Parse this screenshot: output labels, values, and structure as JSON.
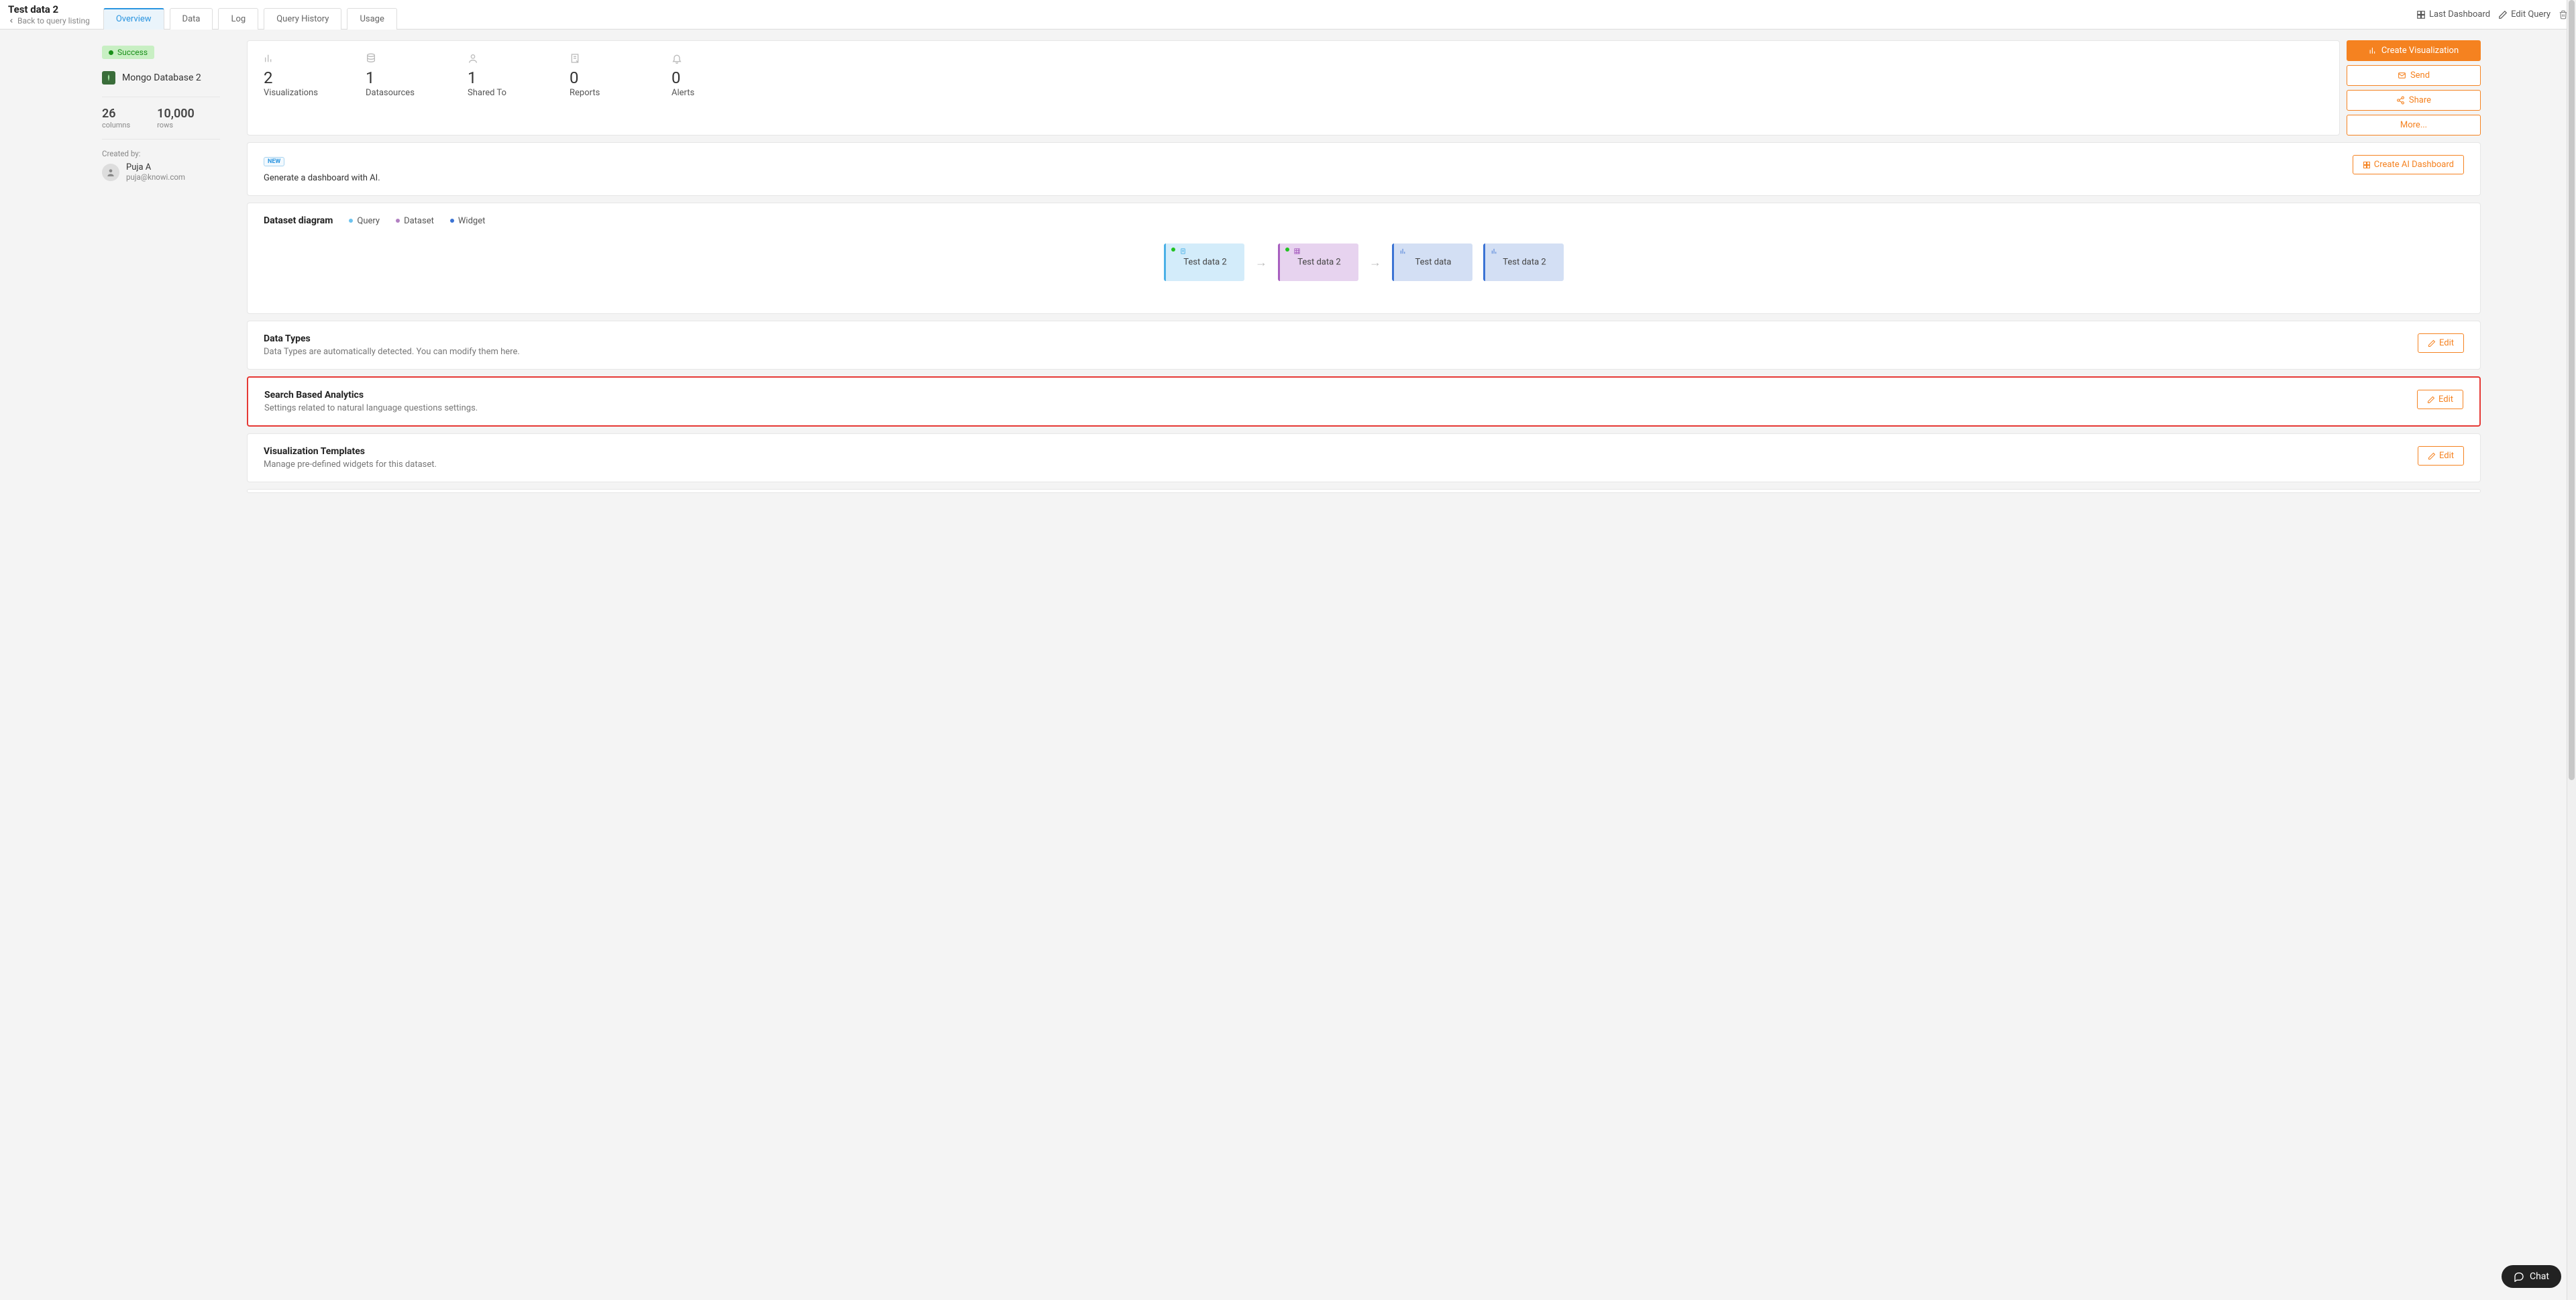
{
  "header": {
    "title": "Test data 2",
    "back_link": "Back to query listing",
    "tabs": [
      "Overview",
      "Data",
      "Log",
      "Query History",
      "Usage"
    ],
    "top_actions": {
      "last_dashboard": "Last Dashboard",
      "edit_query": "Edit Query"
    }
  },
  "sidebar": {
    "status": "Success",
    "database_name": "Mongo Database 2",
    "columns": {
      "value": "26",
      "label": "columns"
    },
    "rows": {
      "value": "10,000",
      "label": "rows"
    },
    "created_by_label": "Created by:",
    "creator": {
      "name": "Puja A",
      "email": "puja@knowi.com"
    }
  },
  "stats": [
    {
      "value": "2",
      "label": "Visualizations"
    },
    {
      "value": "1",
      "label": "Datasources"
    },
    {
      "value": "1",
      "label": "Shared To"
    },
    {
      "value": "0",
      "label": "Reports"
    },
    {
      "value": "0",
      "label": "Alerts"
    }
  ],
  "actions": {
    "create_visualization": "Create Visualization",
    "send": "Send",
    "share": "Share",
    "more": "More..."
  },
  "ai_card": {
    "new_badge": "NEW",
    "text": "Generate a dashboard with AI.",
    "button": "Create AI Dashboard"
  },
  "diagram": {
    "title": "Dataset diagram",
    "legend": {
      "query": "Query",
      "dataset": "Dataset",
      "widget": "Widget"
    },
    "nodes": [
      {
        "label": "Test data 2",
        "type": "q"
      },
      {
        "label": "Test data 2",
        "type": "d"
      },
      {
        "label": "Test data",
        "type": "w"
      },
      {
        "label": "Test data 2",
        "type": "w"
      }
    ]
  },
  "sections": {
    "data_types": {
      "title": "Data Types",
      "desc": "Data Types are automatically detected. You can modify them here.",
      "edit": "Edit"
    },
    "search_analytics": {
      "title": "Search Based Analytics",
      "desc": "Settings related to natural language questions settings.",
      "edit": "Edit"
    },
    "viz_templates": {
      "title": "Visualization Templates",
      "desc": "Manage pre-defined widgets for this dataset.",
      "edit": "Edit"
    }
  },
  "chat": {
    "label": "Chat"
  }
}
